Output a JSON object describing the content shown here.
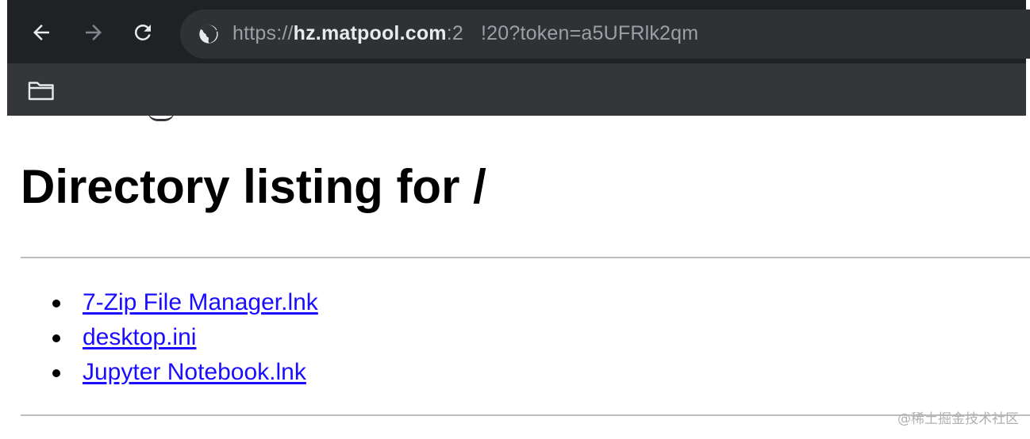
{
  "browser": {
    "url": {
      "scheme": "https://",
      "host": "hz.matpool.com",
      "port_prefix": ":2",
      "rest": "!20?token=a5UFRlk2qm"
    },
    "colors": {
      "toolbar": "#202124",
      "bookmarks_bar": "#35363a",
      "omnibox": "#303134",
      "icon": "#e8eaed",
      "icon_disabled": "#80868b"
    }
  },
  "page": {
    "title": "Directory listing for /",
    "files": [
      {
        "name": "7-Zip File Manager.lnk"
      },
      {
        "name": "desktop.ini"
      },
      {
        "name": "Jupyter Notebook.lnk"
      }
    ],
    "link_color": "#1a0dff"
  },
  "watermark": "@稀土掘金技术社区"
}
